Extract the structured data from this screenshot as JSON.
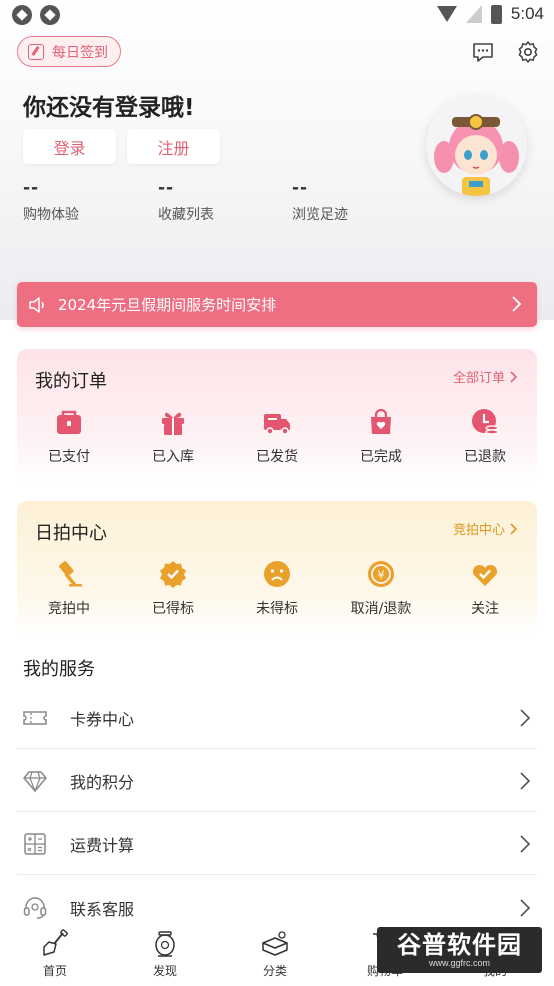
{
  "status_bar": {
    "time": "5:04"
  },
  "header": {
    "checkin_label": "每日签到",
    "title": "你还没有登录哦!",
    "login_label": "登录",
    "register_label": "注册",
    "stats": [
      {
        "value": "--",
        "label": "购物体验"
      },
      {
        "value": "--",
        "label": "收藏列表"
      },
      {
        "value": "--",
        "label": "浏览足迹"
      }
    ]
  },
  "notice": {
    "text": "2024年元旦假期间服务时间安排"
  },
  "orders": {
    "title": "我的订单",
    "link": "全部订单",
    "items": [
      {
        "label": "已支付",
        "icon": "wallet-icon"
      },
      {
        "label": "已入库",
        "icon": "gift-icon"
      },
      {
        "label": "已发货",
        "icon": "truck-icon"
      },
      {
        "label": "已完成",
        "icon": "bag-heart-icon"
      },
      {
        "label": "已退款",
        "icon": "refund-icon"
      }
    ]
  },
  "auction": {
    "title": "日拍中心",
    "link": "竞拍中心",
    "items": [
      {
        "label": "竞拍中",
        "icon": "gavel-icon"
      },
      {
        "label": "已得标",
        "icon": "badge-check-icon"
      },
      {
        "label": "未得标",
        "icon": "sad-face-icon"
      },
      {
        "label": "取消/退款",
        "icon": "yen-refund-icon"
      },
      {
        "label": "关注",
        "icon": "heart-check-icon"
      }
    ]
  },
  "services": {
    "title": "我的服务",
    "items": [
      {
        "label": "卡券中心",
        "icon": "coupon-icon"
      },
      {
        "label": "我的积分",
        "icon": "diamond-icon"
      },
      {
        "label": "运费计算",
        "icon": "calculator-icon"
      },
      {
        "label": "联系客服",
        "icon": "headset-icon"
      }
    ]
  },
  "bottom_nav": [
    {
      "label": "首页",
      "icon": "shovel-icon"
    },
    {
      "label": "发现",
      "icon": "lantern-icon"
    },
    {
      "label": "分类",
      "icon": "category-box-icon"
    },
    {
      "label": "购物车",
      "icon": "cart-icon"
    },
    {
      "label": "我的",
      "icon": "user-icon"
    }
  ],
  "watermark": {
    "title": "谷普软件园",
    "subtitle": "www.ggfrc.com"
  },
  "colors": {
    "accent": "#e06477",
    "banner": "#ee6e82",
    "gold": "#e9a62a"
  }
}
